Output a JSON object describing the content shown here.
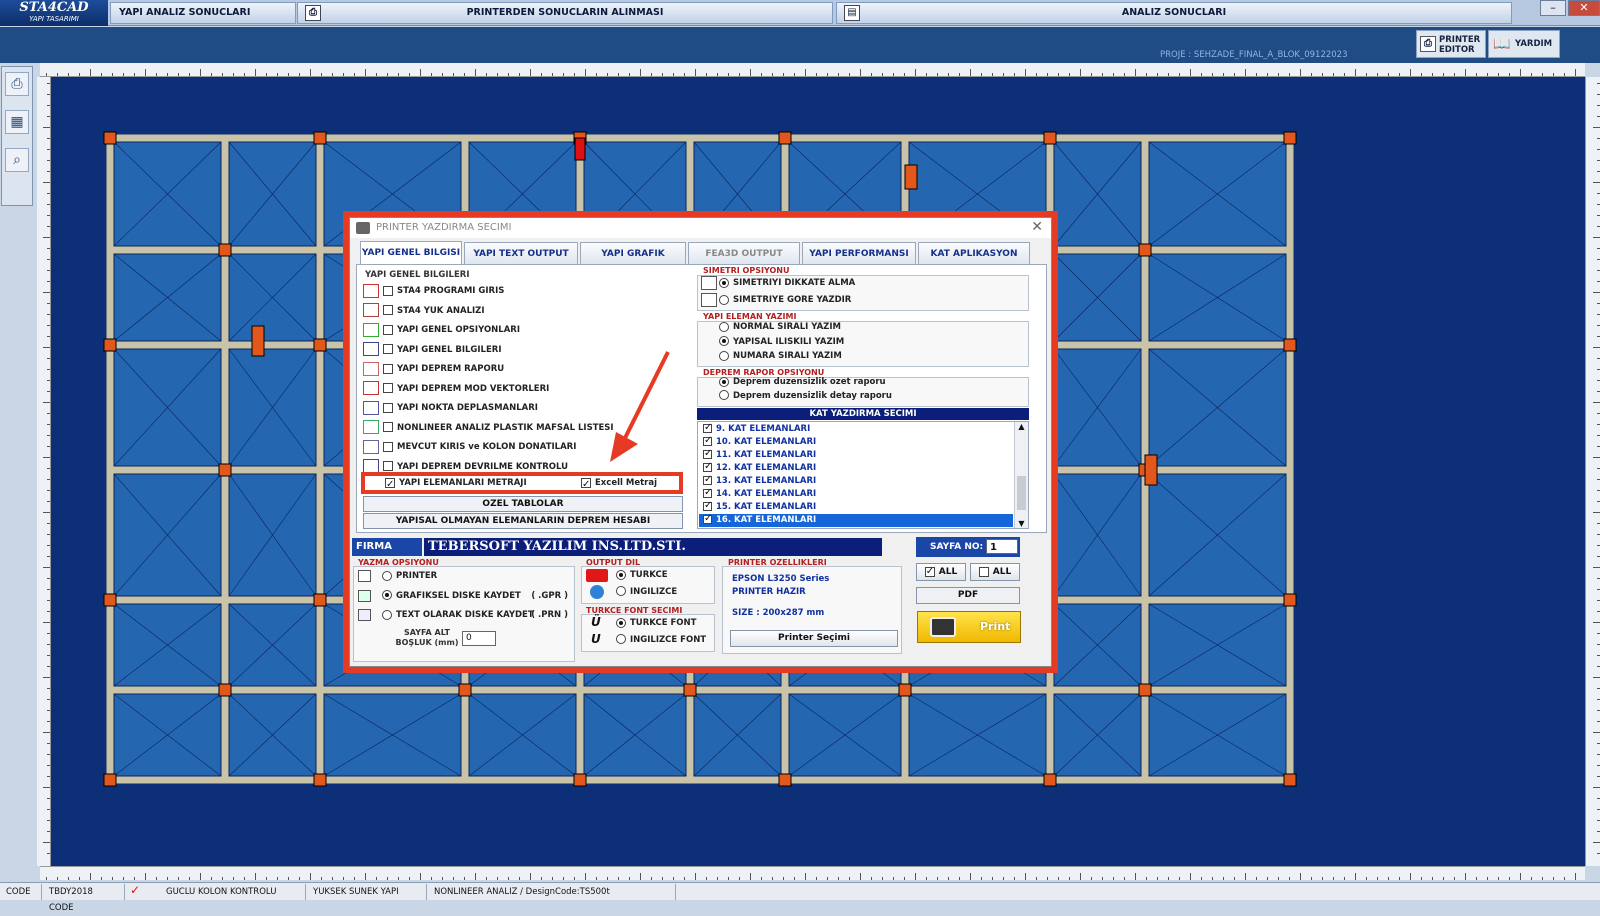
{
  "app": {
    "logo_title": "STA4CAD",
    "logo_subtitle": "YAPI TASARIMI",
    "tabs": [
      {
        "label": "YAPI ANALIZ SONUCLARI"
      },
      {
        "label": "PRINTERDEN SONUCLARIN ALINMASI"
      },
      {
        "label": "ANALIZ SONUCLARI"
      }
    ],
    "project": "PROJE : SEHZADE_FINAL_A_BLOK_09122023",
    "printer_editor_label": "PRINTER EDITOR",
    "help_label": "YARDIM"
  },
  "status_bar": [
    "CODE",
    "TBDY2018 CODE",
    "GUCLU KOLON KONTROLU",
    "YUKSEK SUNEK YAPI",
    "NONLINEER ANALIZ / DesignCode:TS500t"
  ],
  "dialog": {
    "title": "PRINTER YAZDIRMA SECIMI",
    "tabs": [
      "YAPI GENEL BILGISI",
      "YAPI TEXT OUTPUT",
      "YAPI GRAFIK OUTPUT",
      "FEA3D OUTPUT",
      "YAPI PERFORMANSI",
      "KAT APLIKASYON CIZIMI"
    ],
    "general_section": "YAPI GENEL BILGILERI",
    "items": [
      {
        "label": "STA4 PROGRAMI GIRIS",
        "checked": false
      },
      {
        "label": "STA4 YUK ANALIZI",
        "checked": false
      },
      {
        "label": "YAPI GENEL OPSIYONLARI",
        "checked": false
      },
      {
        "label": "YAPI GENEL BILGILERI",
        "checked": false
      },
      {
        "label": "YAPI DEPREM RAPORU",
        "checked": false
      },
      {
        "label": "YAPI DEPREM MOD VEKTORLERI",
        "checked": false
      },
      {
        "label": "YAPI NOKTA DEPLASMANLARI",
        "checked": false
      },
      {
        "label": "NONLINEER ANALIZ PLASTIK MAFSAL LISTESI",
        "checked": false
      },
      {
        "label": "MEVCUT KIRIS ve KOLON DONATILARI",
        "checked": false
      },
      {
        "label": "YAPI DEPREM DEVRILME KONTROLU",
        "checked": false
      }
    ],
    "metraj": {
      "label": "YAPI ELEMANLARI METRAJI",
      "checked": true,
      "excel_label": "Excell Metraj",
      "excel_checked": true
    },
    "ozel_tablolar": "OZEL TABLOLAR",
    "nonstructural": "YAPISAL OLMAYAN ELEMANLARIN DEPREM HESABI",
    "symmetry": {
      "title": "SIMETRI OPSIYONU",
      "options": [
        {
          "label": "SIMETRIYI DIKKATE ALMA",
          "selected": true
        },
        {
          "label": "SIMETRIYE GORE YAZDIR",
          "selected": false
        }
      ]
    },
    "element_print": {
      "title": "YAPI ELEMAN YAZIMI",
      "options": [
        {
          "label": "NORMAL SIRALI YAZIM",
          "selected": false
        },
        {
          "label": "YAPISAL ILISKILI YAZIM",
          "selected": true
        },
        {
          "label": "NUMARA SIRALI YAZIM",
          "selected": false
        }
      ]
    },
    "eq_report": {
      "title": "DEPREM RAPOR OPSIYONU",
      "options": [
        {
          "label": "Deprem duzensizlik ozet raporu",
          "selected": true
        },
        {
          "label": "Deprem duzensizlik detay raporu",
          "selected": false
        }
      ]
    },
    "floors": {
      "title": "KAT YAZDIRMA SECIMI",
      "items": [
        {
          "label": "9. KAT ELEMANLARI",
          "checked": true
        },
        {
          "label": "10. KAT ELEMANLARI",
          "checked": true
        },
        {
          "label": "11. KAT ELEMANLARI",
          "checked": true
        },
        {
          "label": "12. KAT ELEMANLARI",
          "checked": true
        },
        {
          "label": "13. KAT ELEMANLARI",
          "checked": true
        },
        {
          "label": "14. KAT ELEMANLARI",
          "checked": true
        },
        {
          "label": "15. KAT ELEMANLARI",
          "checked": true
        },
        {
          "label": "16. KAT ELEMANLARI",
          "checked": true,
          "selected": true
        }
      ]
    },
    "firma_label": "FIRMA",
    "firma_value": "TEBERSOFT YAZILIM INS.LTD.STI.",
    "sayfa_label": "SAYFA NO:",
    "sayfa_value": "1",
    "yazma": {
      "title": "YAZMA OPSIYONU",
      "options": [
        {
          "label": "PRINTER",
          "ext": "",
          "selected": false
        },
        {
          "label": "GRAFIKSEL DISKE KAYDET",
          "ext": "( .GPR )",
          "selected": true
        },
        {
          "label": "TEXT OLARAK DISKE KAYDET",
          "ext": "( .PRN )",
          "selected": false
        }
      ],
      "margin_label": "SAYFA ALT BOŞLUK (mm)",
      "margin_value": "0"
    },
    "output_lang": {
      "title": "OUTPUT DIL",
      "options": [
        {
          "label": "TURKCE",
          "selected": true
        },
        {
          "label": "INGILIZCE",
          "selected": false
        }
      ]
    },
    "font_sel": {
      "title": "TURKCE FONT SECIMI",
      "options": [
        {
          "label": "TURKCE FONT",
          "selected": true
        },
        {
          "label": "INGILIZCE FONT",
          "selected": false
        }
      ]
    },
    "printer_props": {
      "title": "PRINTER OZELLIKLERI",
      "name": "EPSON L3250 Series",
      "status": "PRINTER HAZIR",
      "size": "SIZE : 200x287  mm",
      "select_btn": "Printer Seçimi"
    },
    "all_label_1": "ALL",
    "all_label_2": "ALL",
    "pdf_label": "PDF",
    "print_label": "Print"
  },
  "colors": {
    "accent_red": "#e53a24",
    "canvas_blue": "#0c2f77",
    "slab_blue": "#2467b0",
    "beam": "#c9c3a7",
    "column": "#e2571b"
  }
}
